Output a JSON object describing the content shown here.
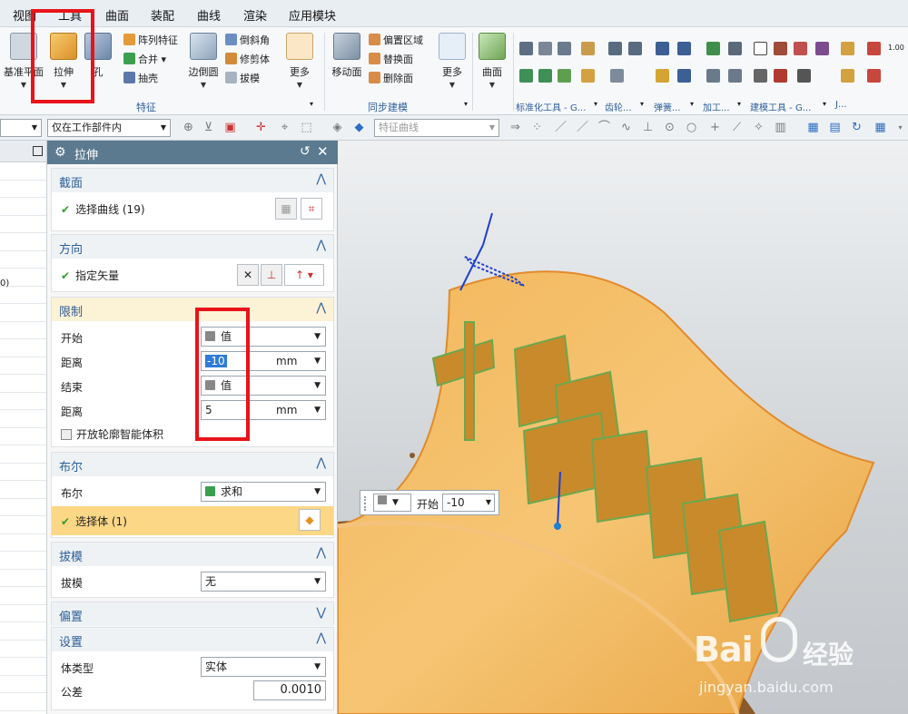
{
  "menu": {
    "items": [
      "视图",
      "工具",
      "曲面",
      "装配",
      "曲线",
      "渲染",
      "应用模块"
    ]
  },
  "ribbon": {
    "big": [
      {
        "label": "基准平面",
        "icon": "datum-plane-icon"
      },
      {
        "label": "拉伸",
        "icon": "extrude-icon"
      },
      {
        "label": "孔",
        "icon": "hole-icon"
      },
      {
        "label": "边倒圆",
        "icon": "edge-blend-icon"
      },
      {
        "label": "更多",
        "icon": "more-icon"
      },
      {
        "label": "移动面",
        "icon": "move-face-icon"
      },
      {
        "label": "更多",
        "icon": "more-icon"
      },
      {
        "label": "曲面",
        "icon": "surface-icon"
      }
    ],
    "small": [
      {
        "label": "阵列特征",
        "icon": "pattern-icon"
      },
      {
        "label": "合并",
        "icon": "unite-icon"
      },
      {
        "label": "抽壳",
        "icon": "shell-icon"
      },
      {
        "label": "倒斜角",
        "icon": "chamfer-icon"
      },
      {
        "label": "修剪体",
        "icon": "trim-body-icon"
      },
      {
        "label": "拔模",
        "icon": "draft-icon"
      },
      {
        "label": "偏置区域",
        "icon": "offset-region-icon"
      },
      {
        "label": "替换面",
        "icon": "replace-face-icon"
      },
      {
        "label": "删除面",
        "icon": "delete-face-icon"
      }
    ],
    "groups": [
      "特征",
      "同步建模",
      "标准化工具 - G...",
      "齿轮...",
      "弹簧...",
      "加工...",
      "建模工具 - G...",
      "J..."
    ],
    "extra_label": "1.00"
  },
  "toolbar2": {
    "filter_value": "仅在工作部件内",
    "curve_placeholder": "特征曲线"
  },
  "dialog": {
    "title": "拉伸",
    "sections": {
      "section": {
        "title": "截面",
        "select_curve": "选择曲线 (19)"
      },
      "direction": {
        "title": "方向",
        "specify_vector": "指定矢量"
      },
      "limits": {
        "title": "限制",
        "start_label": "开始",
        "start_value": "值",
        "distance_label": "距离",
        "distance_value": "-10",
        "unit": "mm",
        "end_label": "结束",
        "end_value": "值",
        "distance2_label": "距离",
        "distance2_value": "5",
        "open_profile": "开放轮廓智能体积"
      },
      "boolean": {
        "title": "布尔",
        "boolean_label": "布尔",
        "boolean_value": "求和",
        "select_body": "选择体 (1)"
      },
      "draft": {
        "title": "拔模",
        "draft_label": "拔模",
        "draft_value": "无"
      },
      "offset": {
        "title": "偏置"
      },
      "settings": {
        "title": "设置",
        "body_type_label": "体类型",
        "body_type_value": "实体",
        "tolerance_label": "公差",
        "tolerance_value": "0.0010"
      }
    }
  },
  "left_nav": {
    "truncated_fragment": "0)"
  },
  "viewport": {
    "floating": {
      "label": "开始",
      "value": "-10"
    },
    "watermark": {
      "brand": "Bai",
      "brand2": "经验",
      "url": "jingyan.baidu.com"
    }
  }
}
